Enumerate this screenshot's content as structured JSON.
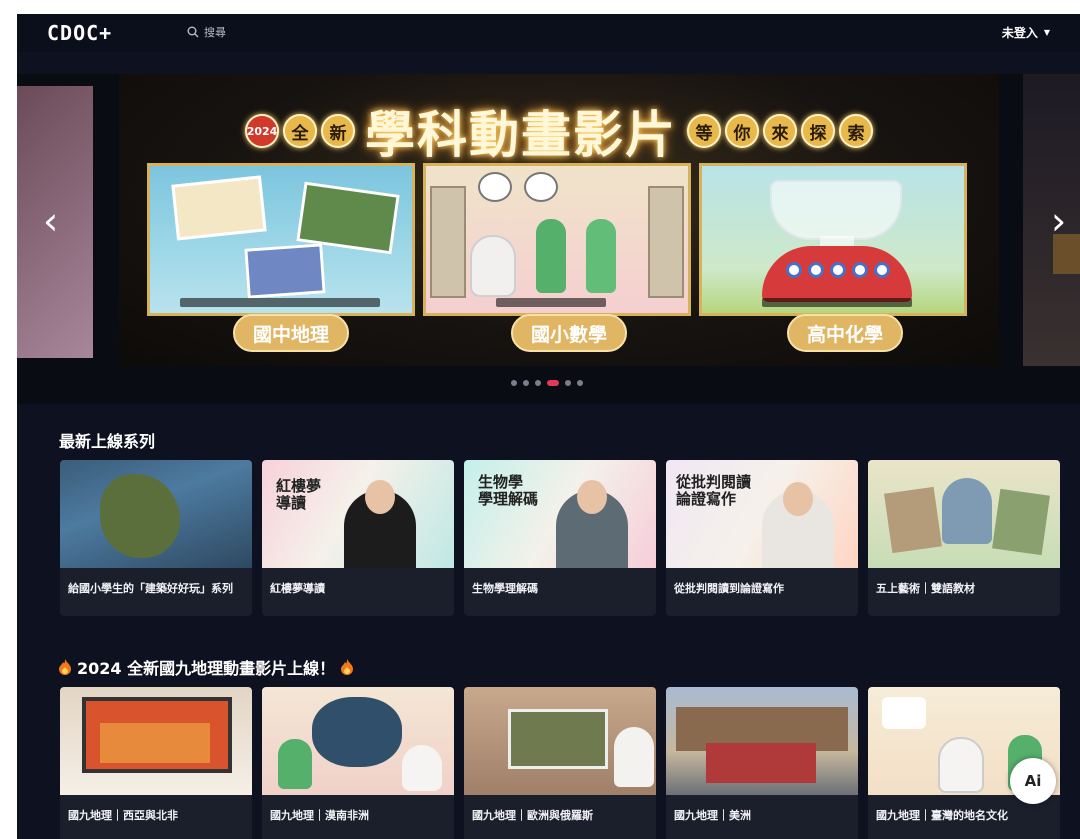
{
  "header": {
    "logo": "CDOC+",
    "search_label": "搜尋",
    "login_label": "未登入"
  },
  "hero": {
    "banner": {
      "year": "2024",
      "prefix": [
        "全",
        "新"
      ],
      "headline": "學科動畫影片",
      "suffix": [
        "等",
        "你",
        "來",
        "探",
        "索"
      ]
    },
    "panels": [
      {
        "caption": "國中地理"
      },
      {
        "caption": "國小數學"
      },
      {
        "caption": "高中化學"
      }
    ],
    "dots_total": 6,
    "active_dot": 4,
    "prev_glyph": "‹",
    "next_glyph": "›"
  },
  "sections": [
    {
      "title": "最新上線系列",
      "items": [
        {
          "label": "給國小學生的「建築好好玩」系列",
          "thumb_text": ""
        },
        {
          "label": "紅樓夢導讀",
          "thumb_text": "紅樓夢\n導讀"
        },
        {
          "label": "生物學理解碼",
          "thumb_text": "生物學\n學理解碼"
        },
        {
          "label": "從批判閱讀到論證寫作",
          "thumb_text": "從批判閱讀\n論證寫作"
        },
        {
          "label": "五上藝術｜雙語教材",
          "thumb_text": ""
        }
      ]
    },
    {
      "title": "2024 全新國九地理動畫影片上線！",
      "items": [
        {
          "label": "國九地理｜西亞與北非"
        },
        {
          "label": "國九地理｜漠南非洲"
        },
        {
          "label": "國九地理｜歐洲與俄羅斯"
        },
        {
          "label": "國九地理｜美洲"
        },
        {
          "label": "國九地理｜臺灣的地名文化"
        }
      ]
    }
  ],
  "ai_button": "Ai",
  "colors": {
    "background": "#0e1220",
    "accent_dot": "#e23a55",
    "caption_gold": "#e0b563"
  },
  "icons": [
    "search-icon",
    "chevron-down-icon",
    "chevron-left-icon",
    "chevron-right-icon",
    "flame-icon",
    "ai-assistant-icon"
  ]
}
